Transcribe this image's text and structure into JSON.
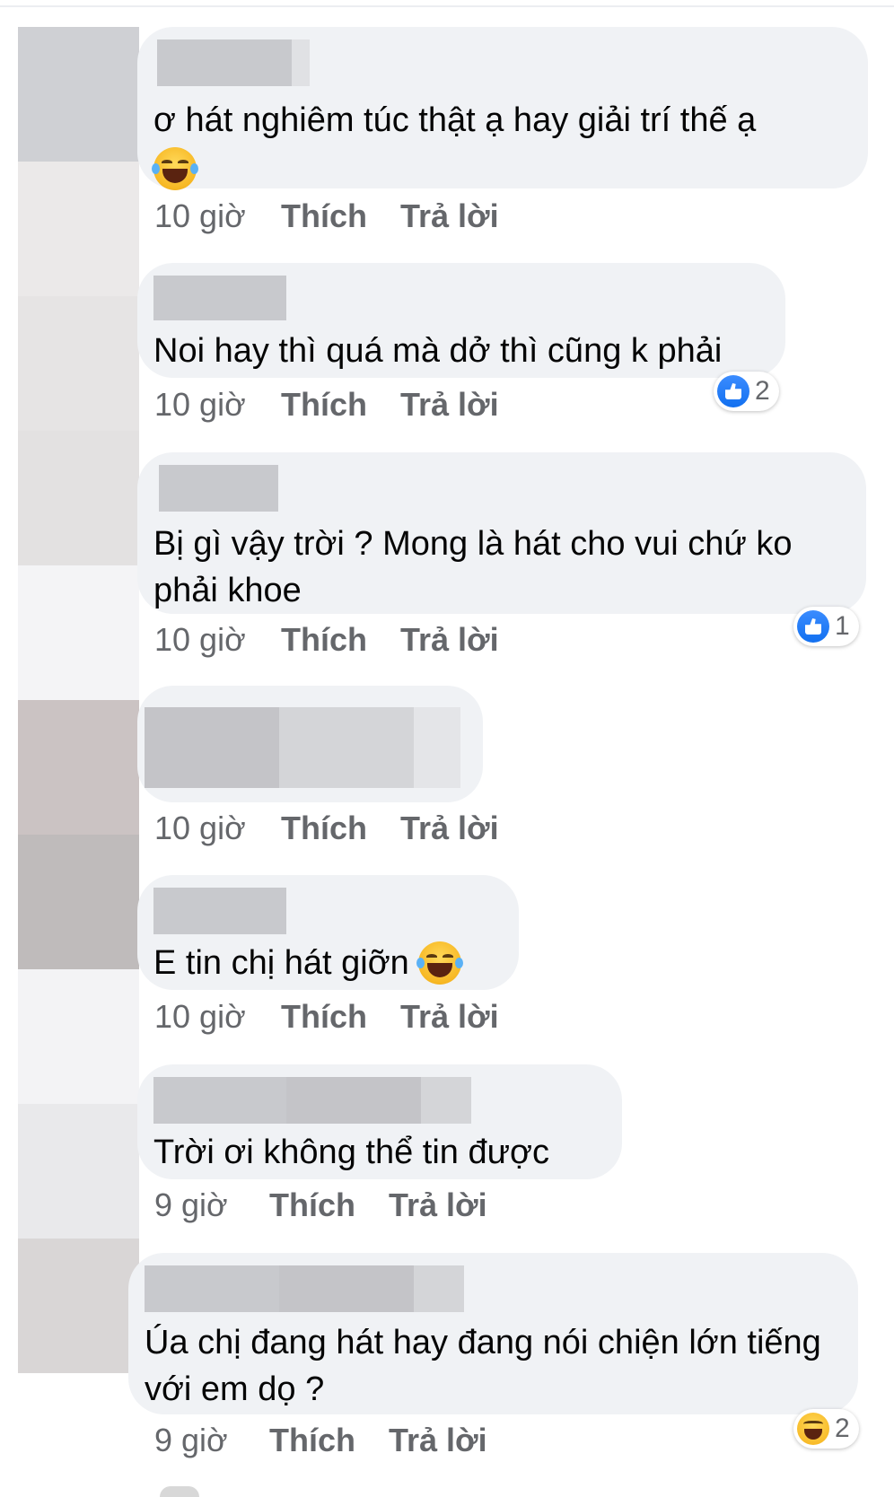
{
  "comments": [
    {
      "text": "ơ hát nghiêm túc thật ạ hay giải trí thế ạ",
      "emoji": "laughing-tears-emoji",
      "time": "10 giờ",
      "like_label": "Thích",
      "reply_label": "Trả lời"
    },
    {
      "text": "Noi hay thì quá mà dở thì cũng k phải",
      "time": "10 giờ",
      "like_label": "Thích",
      "reply_label": "Trả lời",
      "reaction": {
        "icon": "like-icon",
        "count": "2"
      }
    },
    {
      "text": "Bị gì vậy trời ? Mong là hát cho vui chứ ko phải khoe",
      "time": "10 giờ",
      "like_label": "Thích",
      "reply_label": "Trả lời",
      "reaction": {
        "icon": "like-icon",
        "count": "1"
      }
    },
    {
      "text": "",
      "time": "10 giờ",
      "like_label": "Thích",
      "reply_label": "Trả lời"
    },
    {
      "text": "E tin chị hát giỡn",
      "emoji": "laughing-tears-emoji",
      "time": "10 giờ",
      "like_label": "Thích",
      "reply_label": "Trả lời"
    },
    {
      "text": "Trời ơi không thể tin được",
      "time": "9 giờ",
      "like_label": "Thích",
      "reply_label": "Trả lời"
    },
    {
      "text": "Úa chị đang hát hay đang nói chiện lớn tiếng với em dọ ?",
      "time": "9 giờ",
      "like_label": "Thích",
      "reply_label": "Trả lời",
      "reaction": {
        "icon": "haha-icon",
        "count": "2"
      }
    }
  ],
  "colors": {
    "bubble": "#f0f2f5",
    "action_text": "#65676b",
    "like_blue": "#1270f0"
  }
}
